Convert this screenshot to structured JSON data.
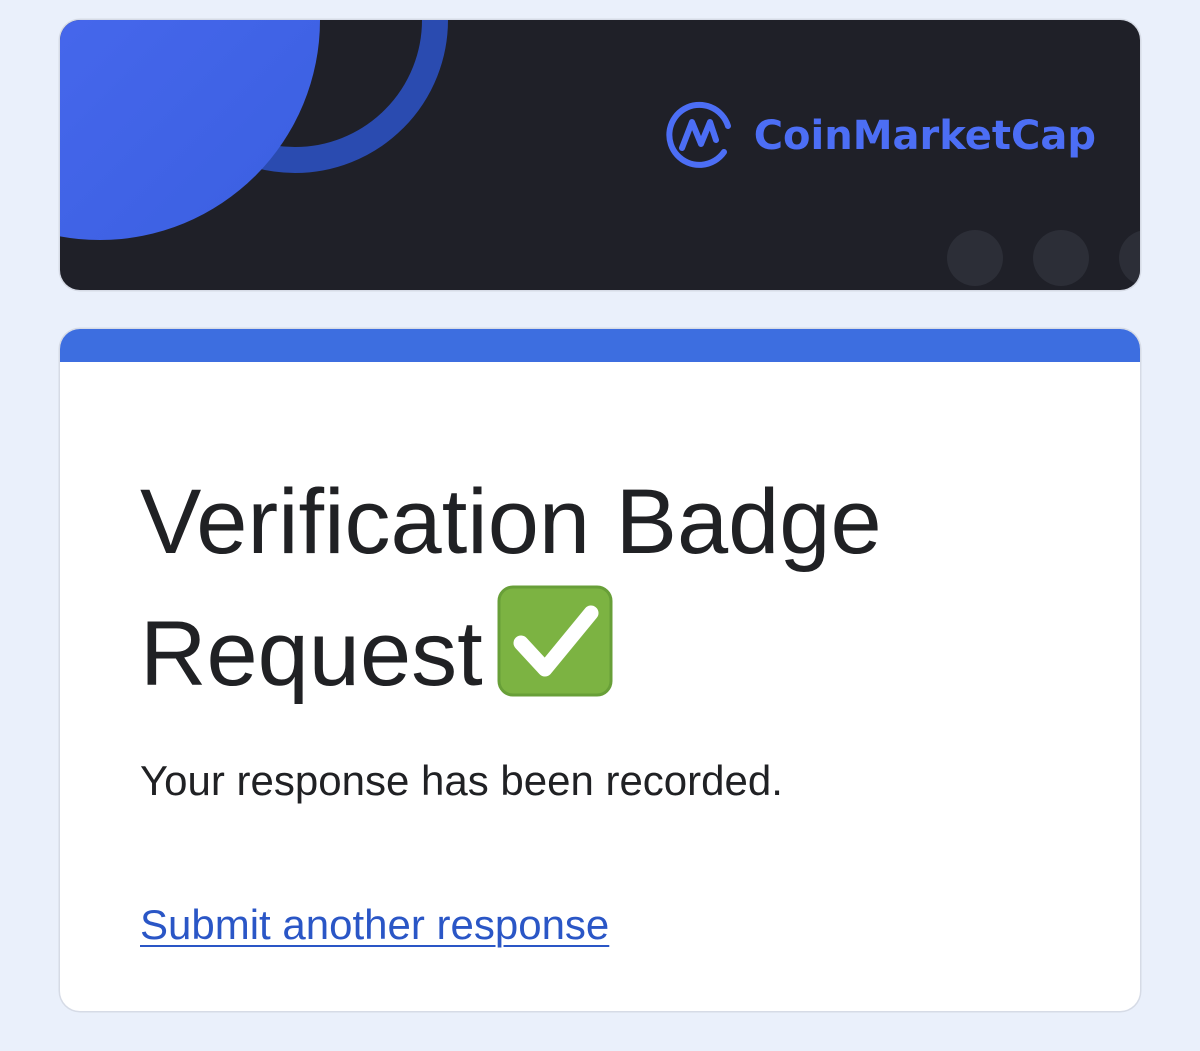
{
  "header": {
    "brand_name": "CoinMarketCap",
    "brand_color": "#4c6ef5",
    "background_color": "#1f2028",
    "logo_icon": "coinmarketcap-logo-icon"
  },
  "form": {
    "accent_color": "#3d6ee0",
    "title_text": "Verification Badge Request",
    "title_icon": "check-mark-button-emoji",
    "confirmation_message": "Your response has been recorded.",
    "submit_another_label": "Submit another response",
    "link_color": "#2a56c6"
  }
}
